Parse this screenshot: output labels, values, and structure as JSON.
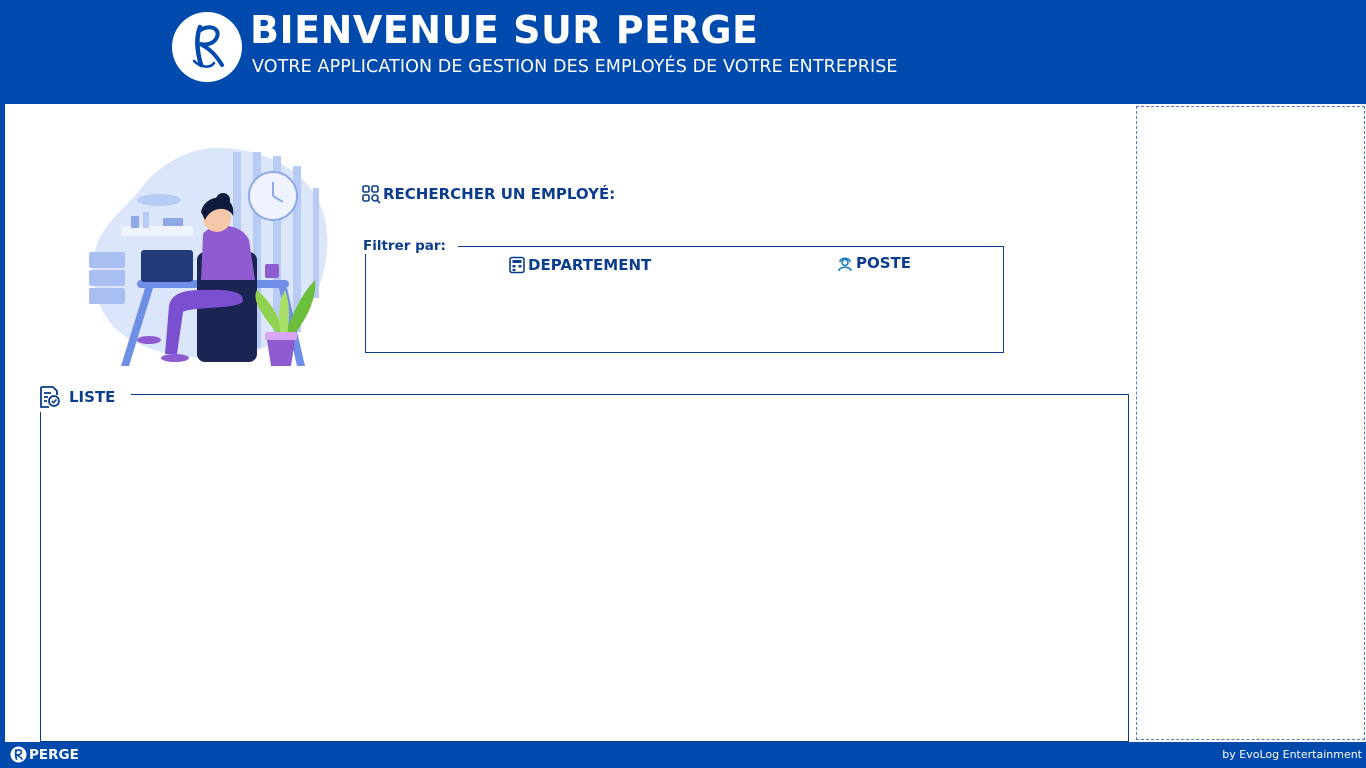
{
  "header": {
    "title": "BIENVENUE SUR PERGE",
    "subtitle": "VOTRE APPLICATION DE GESTION DES EMPLOYÉS DE VOTRE ENTREPRISE",
    "logo_icon": "perge-logo-icon"
  },
  "search": {
    "title": "RECHERCHER UN EMPLOYÉ:",
    "icon": "search-grid-icon",
    "filter_label": "Filtrer par:",
    "filters": [
      {
        "label": "DEPARTEMENT",
        "icon": "building-icon"
      },
      {
        "label": "POSTE",
        "icon": "worker-icon"
      }
    ]
  },
  "list": {
    "label": "LISTE",
    "icon": "document-check-icon"
  },
  "footer": {
    "brand": "PERGE",
    "credit": "by EvoLog Entertainment"
  },
  "colors": {
    "primary": "#0049ad",
    "accent_text": "#0b3d8c",
    "background": "#ffffff"
  }
}
